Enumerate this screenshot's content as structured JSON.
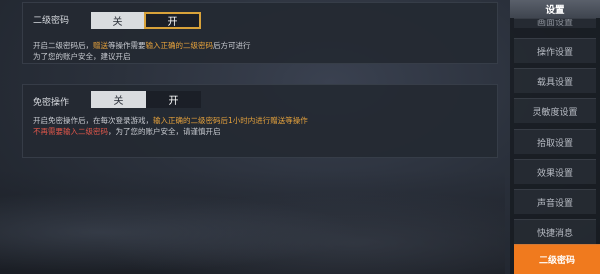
{
  "settings": [
    {
      "label": "二级密码",
      "toggle": {
        "off": "关",
        "on": "开",
        "selected": "开"
      },
      "description": {
        "line1": {
          "a": "开启二级密码后，",
          "b": "赠送",
          "c": "等操作需要",
          "d": "输入正确的二级密码",
          "e": "后方可进行"
        },
        "line2": "为了您的账户安全，建议开启"
      }
    },
    {
      "label": "免密操作",
      "toggle": {
        "off": "关",
        "on": "开",
        "selected": "开"
      },
      "description": {
        "line1": {
          "a": "开启免密操作后，在每次登录游戏，",
          "b": "输入正确的二级密码后1小时内进行赠送等操作"
        },
        "line2": {
          "a": "不再需要输入二级密码",
          "b": "，为了您的账户安全，请谨慎开启"
        }
      }
    }
  ],
  "sidebar": {
    "title": "设置",
    "items": [
      {
        "label": "画面设置"
      },
      {
        "label": "操作设置"
      },
      {
        "label": "载具设置"
      },
      {
        "label": "灵敏度设置"
      },
      {
        "label": "拾取设置"
      },
      {
        "label": "效果设置"
      },
      {
        "label": "声音设置"
      },
      {
        "label": "快捷消息"
      },
      {
        "label": "二级密码"
      }
    ],
    "active": "二级密码"
  },
  "colors": {
    "accent": "#f07a1e",
    "highlight_orange": "#e6a23c",
    "highlight_red": "#e0564a",
    "selected_border": "#d8a23a"
  }
}
